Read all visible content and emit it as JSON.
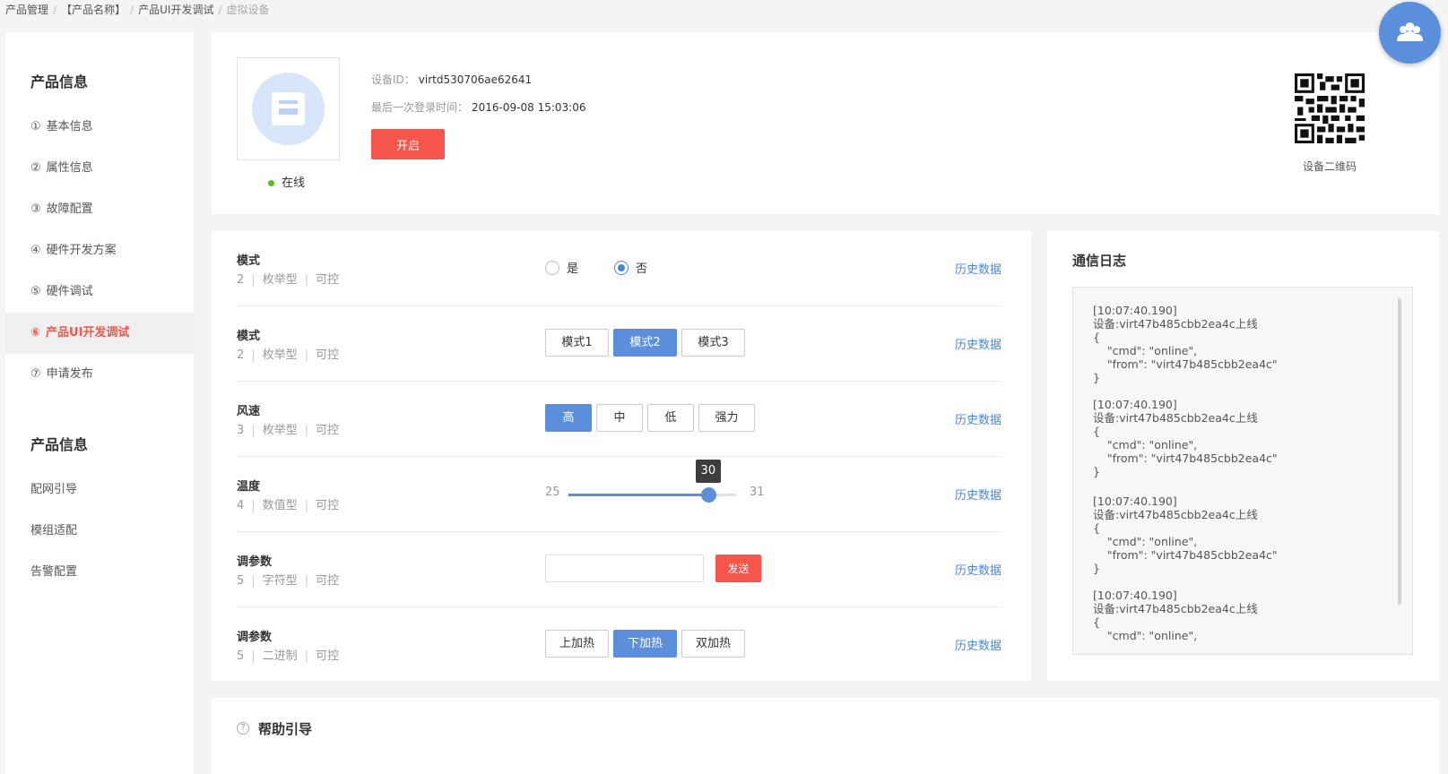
{
  "breadcrumb": {
    "items": [
      "产品管理",
      "【产品名称】",
      "产品UI开发调试"
    ],
    "current": "虚拟设备",
    "separator": "/"
  },
  "sidebar": {
    "section1_title": "产品信息",
    "items": [
      {
        "num": "①",
        "label": "基本信息"
      },
      {
        "num": "②",
        "label": "属性信息"
      },
      {
        "num": "③",
        "label": "故障配置"
      },
      {
        "num": "④",
        "label": "硬件开发方案"
      },
      {
        "num": "⑤",
        "label": "硬件调试"
      },
      {
        "num": "⑥",
        "label": "产品UI开发调试"
      },
      {
        "num": "⑦",
        "label": "申请发布"
      }
    ],
    "section2_title": "产品信息",
    "items2": [
      "配网引导",
      "模组适配",
      "告警配置"
    ]
  },
  "device": {
    "id_label": "设备ID：",
    "id_value": "virtd530706ae62641",
    "last_login_label": "最后一次登录时间：",
    "last_login_value": "2016-09-08   15:03:06",
    "open_button": "开启",
    "status": "在线",
    "qr_label": "设备二维码"
  },
  "properties": {
    "history_label": "历史数据",
    "rows": [
      {
        "name": "模式",
        "num": "2",
        "type": "枚举型",
        "access": "可控",
        "radio_yes": "是",
        "radio_no": "否"
      },
      {
        "name": "模式",
        "num": "2",
        "type": "枚举型",
        "access": "可控",
        "options": [
          "模式1",
          "模式2",
          "模式3"
        ]
      },
      {
        "name": "风速",
        "num": "3",
        "type": "枚举型",
        "access": "可控",
        "options": [
          "高",
          "中",
          "低",
          "强力"
        ]
      },
      {
        "name": "温度",
        "num": "4",
        "type": "数值型",
        "access": "可控",
        "min": "25",
        "max": "31",
        "value": "30"
      },
      {
        "name": "调参数",
        "num": "5",
        "type": "字符型",
        "access": "可控",
        "send": "发送"
      },
      {
        "name": "调参数",
        "num": "5",
        "type": "二进制",
        "access": "可控",
        "options": [
          "上加热",
          "下加热",
          "双加热"
        ]
      }
    ]
  },
  "slider": {
    "min": 25,
    "max": 31,
    "value": 30
  },
  "log": {
    "title": "通信日志",
    "entries": [
      "[10:07:40.190]\n设备:virt47b485cbb2ea4c上线\n{\n    \"cmd\": \"online\",\n    \"from\": \"virt47b485cbb2ea4c\"\n}",
      "[10:07:40.190]\n设备:virt47b485cbb2ea4c上线\n{\n    \"cmd\": \"online\",\n    \"from\": \"virt47b485cbb2ea4c\"\n}",
      "[10:07:40.190]\n设备:virt47b485cbb2ea4c上线\n{\n    \"cmd\": \"online\",\n    \"from\": \"virt47b485cbb2ea4c\"\n}",
      "[10:07:40.190]\n设备:virt47b485cbb2ea4c上线\n{\n    \"cmd\": \"online\","
    ]
  },
  "help": {
    "icon": "?",
    "title": "帮助引导"
  },
  "colors": {
    "accent": "#5b8fdb",
    "danger": "#f5554a",
    "online": "#52c41a"
  }
}
